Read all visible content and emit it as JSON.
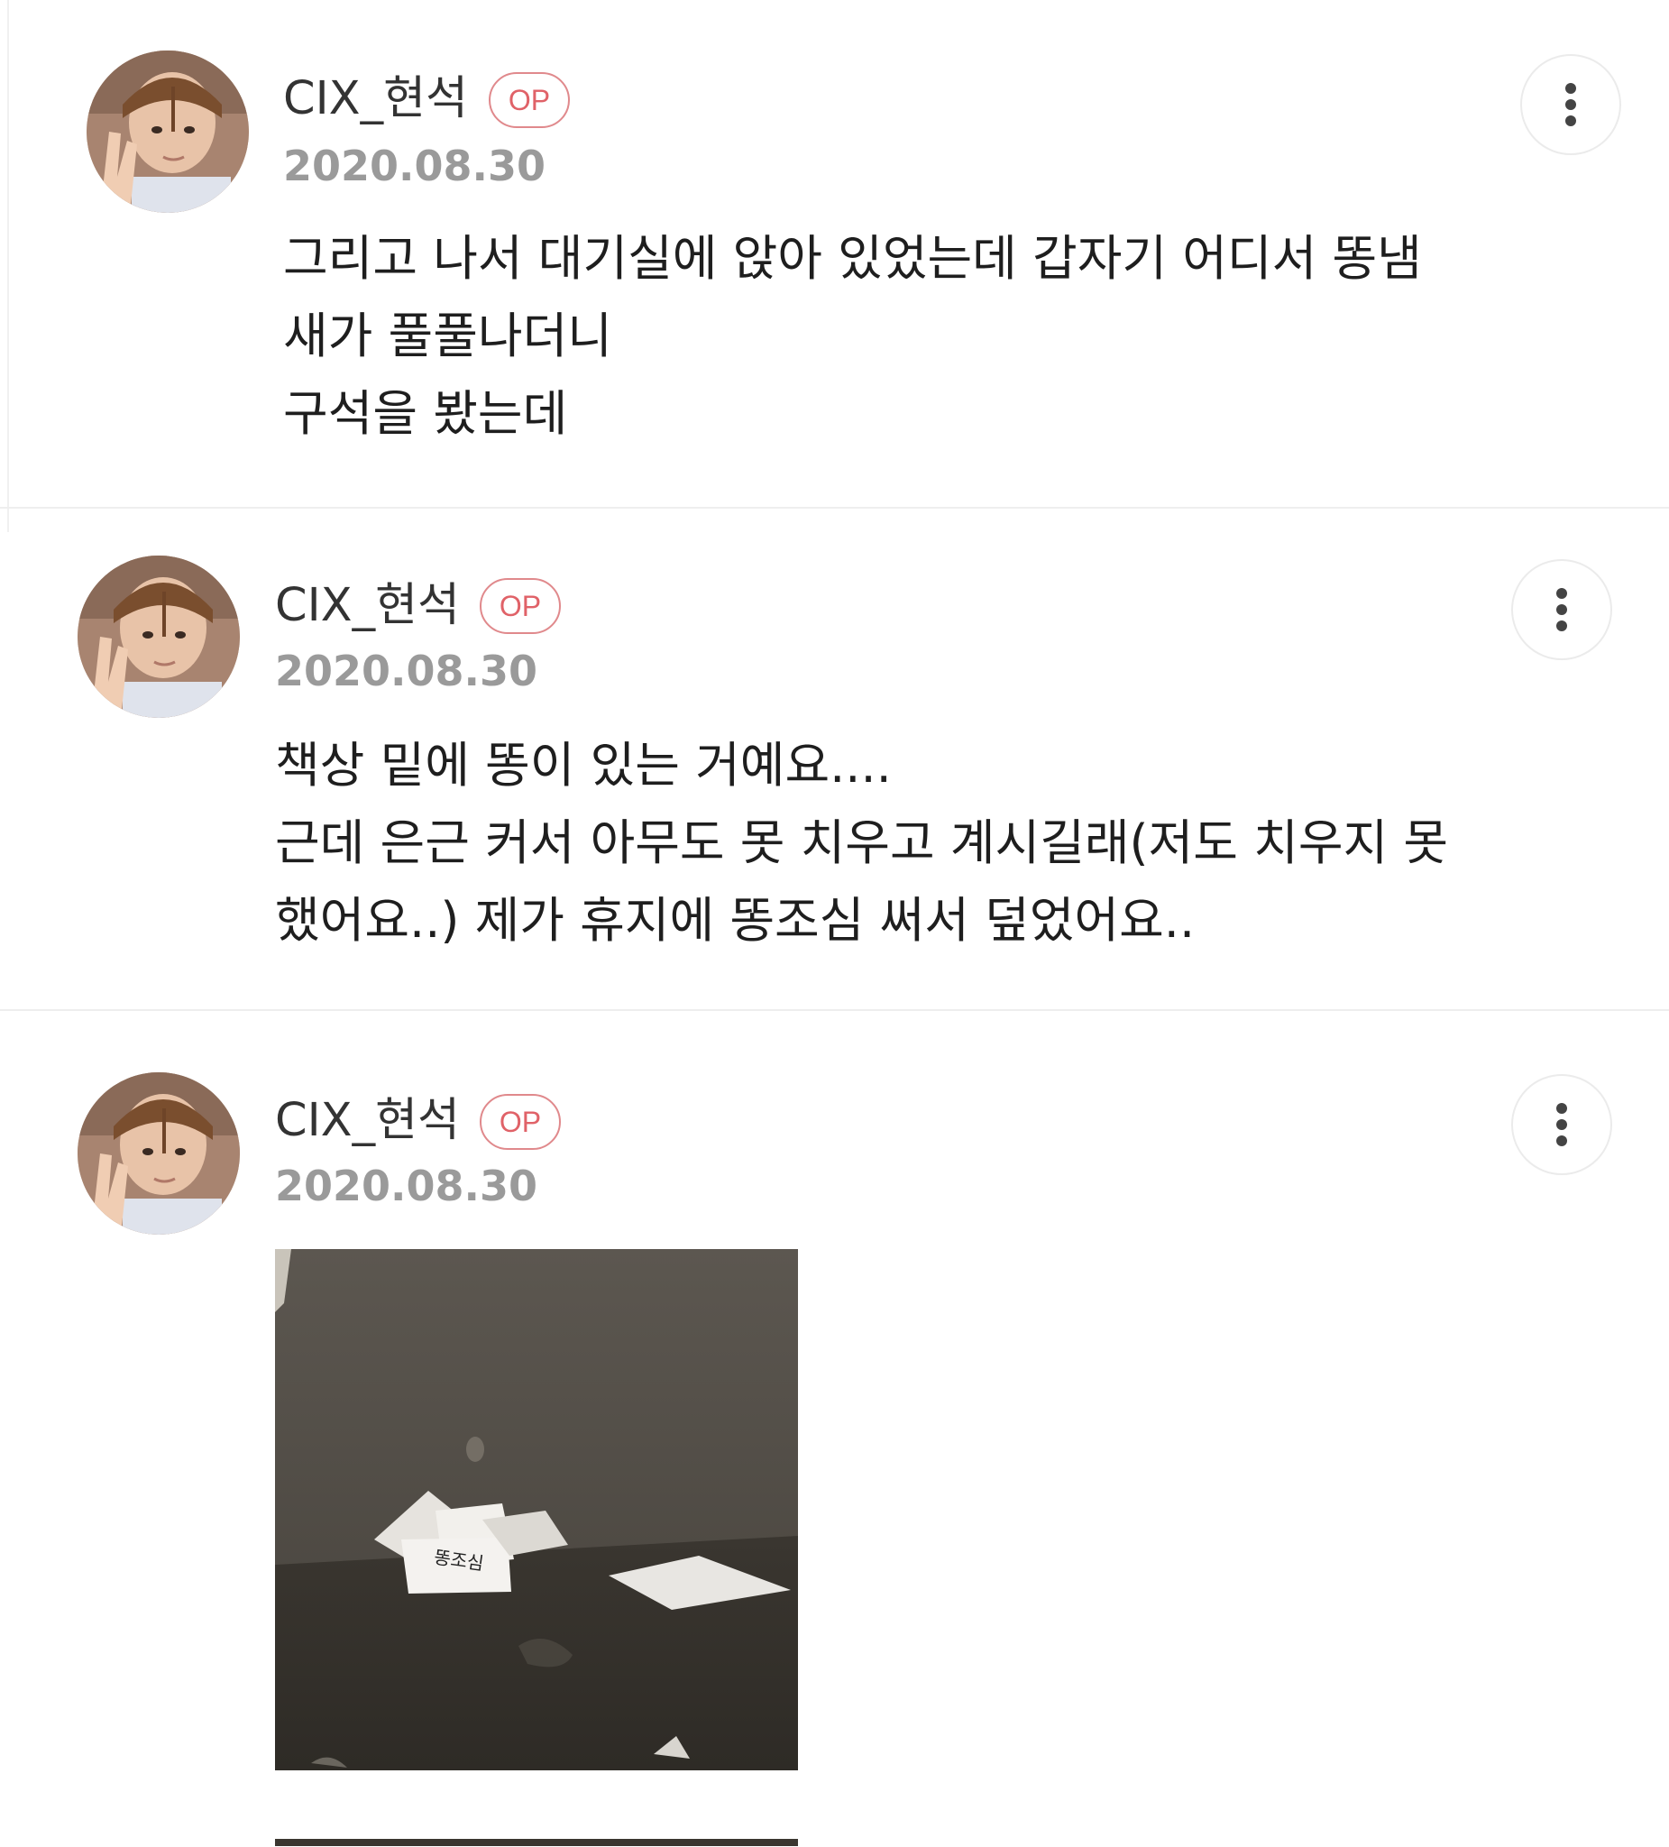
{
  "posts": [
    {
      "username": "CIX_현석",
      "badge": "OP",
      "date": "2020.08.30",
      "lines": [
        "그리고 나서 대기실에 앉아 있었는데 갑자기 어디서 똥냄",
        "새가 풀풀나더니",
        "구석을 봤는데"
      ]
    },
    {
      "username": "CIX_현석",
      "badge": "OP",
      "date": "2020.08.30",
      "lines": [
        "책상 밑에 똥이 있는 거예요....",
        "근데 은근 커서 아무도 못 치우고 계시길래(저도 치우지 못",
        "했어요..) 제가 휴지에 똥조심 써서 덮었어요.."
      ]
    },
    {
      "username": "CIX_현석",
      "badge": "OP",
      "date": "2020.08.30",
      "lines": [],
      "image": {
        "paper_label": "똥조심"
      }
    }
  ],
  "colors": {
    "badge": "#e06268",
    "date": "#9a9a9a",
    "text": "#1e1e1e",
    "divider": "#eeeeee"
  },
  "icons": {
    "more": "more-vertical-icon",
    "avatar": "profile-photo"
  }
}
